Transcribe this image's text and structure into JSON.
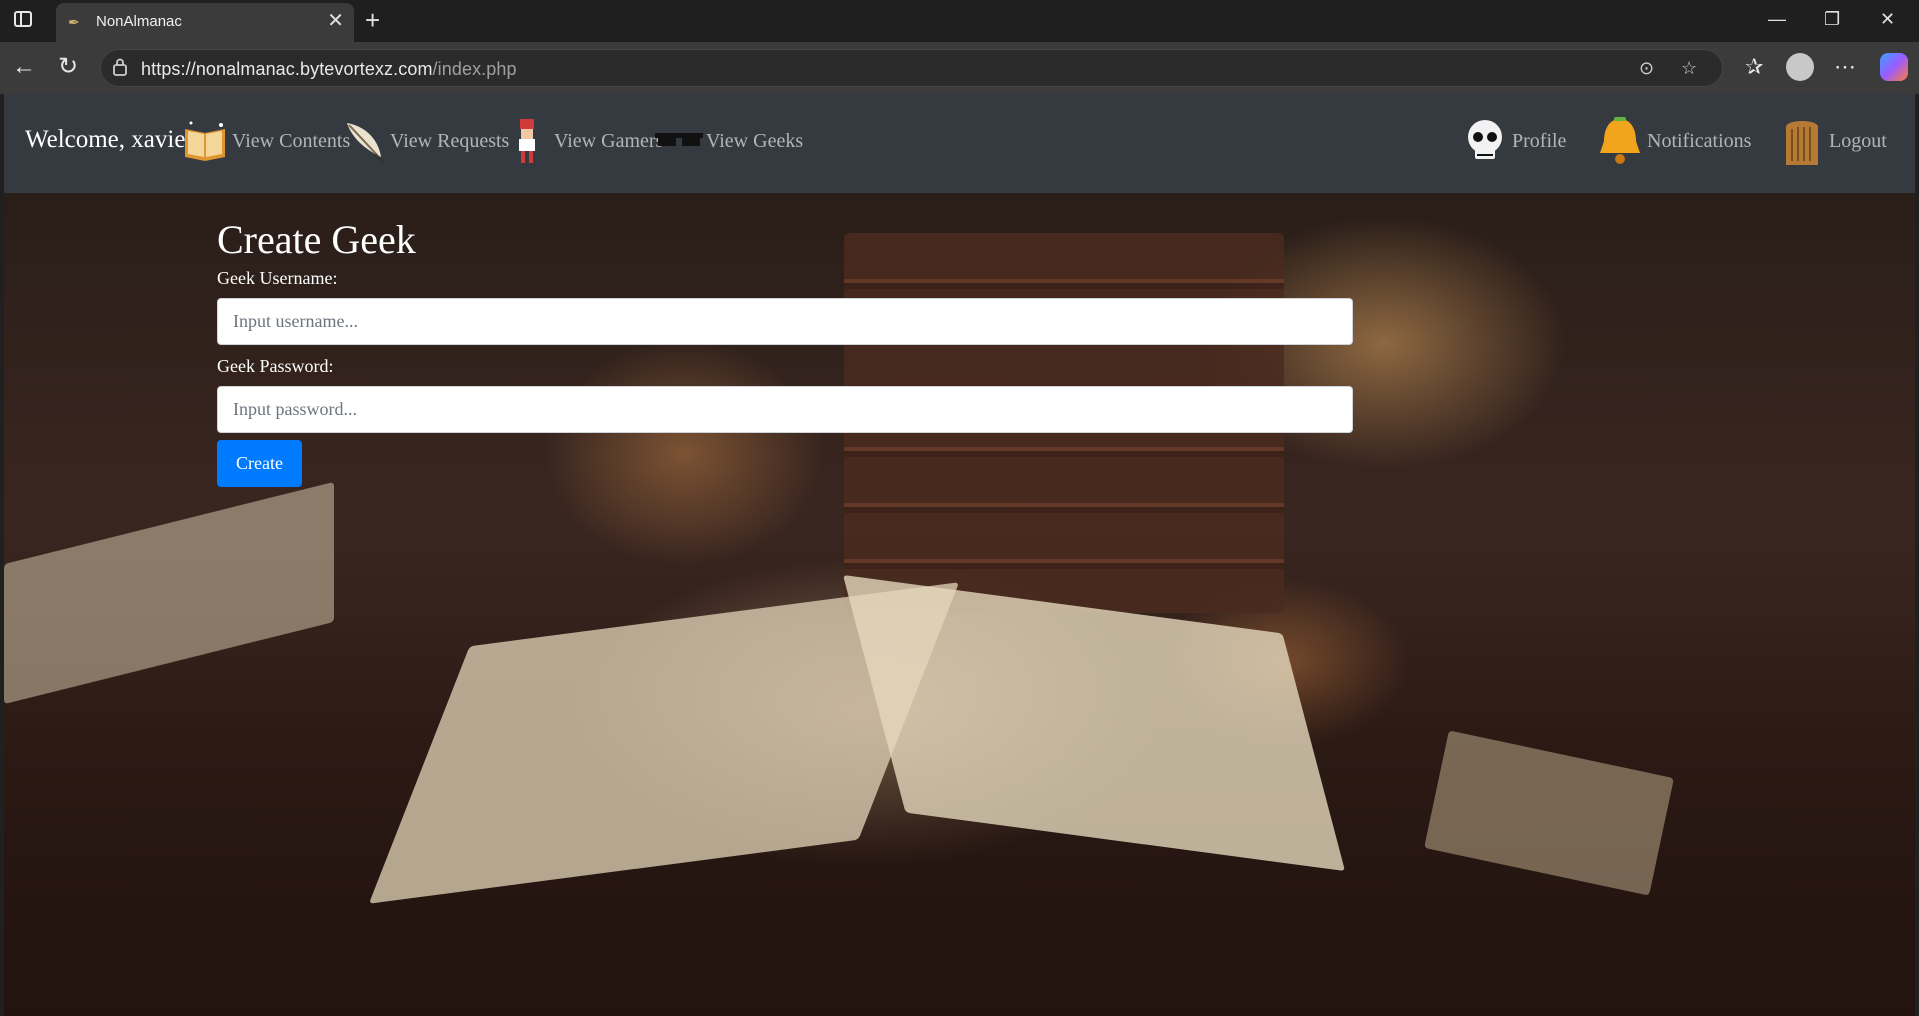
{
  "browser": {
    "tab_title": "NonAlmanac",
    "url_host": "https://nonalmanac.bytevortexz.com",
    "url_path": "/index.php"
  },
  "navbar": {
    "brand": "Welcome, xavier",
    "links": [
      {
        "label": "View Contents",
        "icon": "book-icon"
      },
      {
        "label": "View Requests",
        "icon": "quill-icon"
      },
      {
        "label": "View Gamers",
        "icon": "gamer-character-icon"
      },
      {
        "label": "View Geeks",
        "icon": "sunglasses-icon"
      }
    ],
    "right_links": [
      {
        "label": "Profile",
        "icon": "skull-icon"
      },
      {
        "label": "Notifications",
        "icon": "bell-icon"
      },
      {
        "label": "Logout",
        "icon": "door-icon"
      }
    ]
  },
  "form": {
    "title": "Create Geek",
    "username_label": "Geek Username:",
    "username_placeholder": "Input username...",
    "password_label": "Geek Password:",
    "password_placeholder": "Input password...",
    "submit_label": "Create"
  },
  "colors": {
    "navbar_bg": "#343a40",
    "primary_button": "#007bff",
    "browser_chrome": "#3b3b3b"
  }
}
